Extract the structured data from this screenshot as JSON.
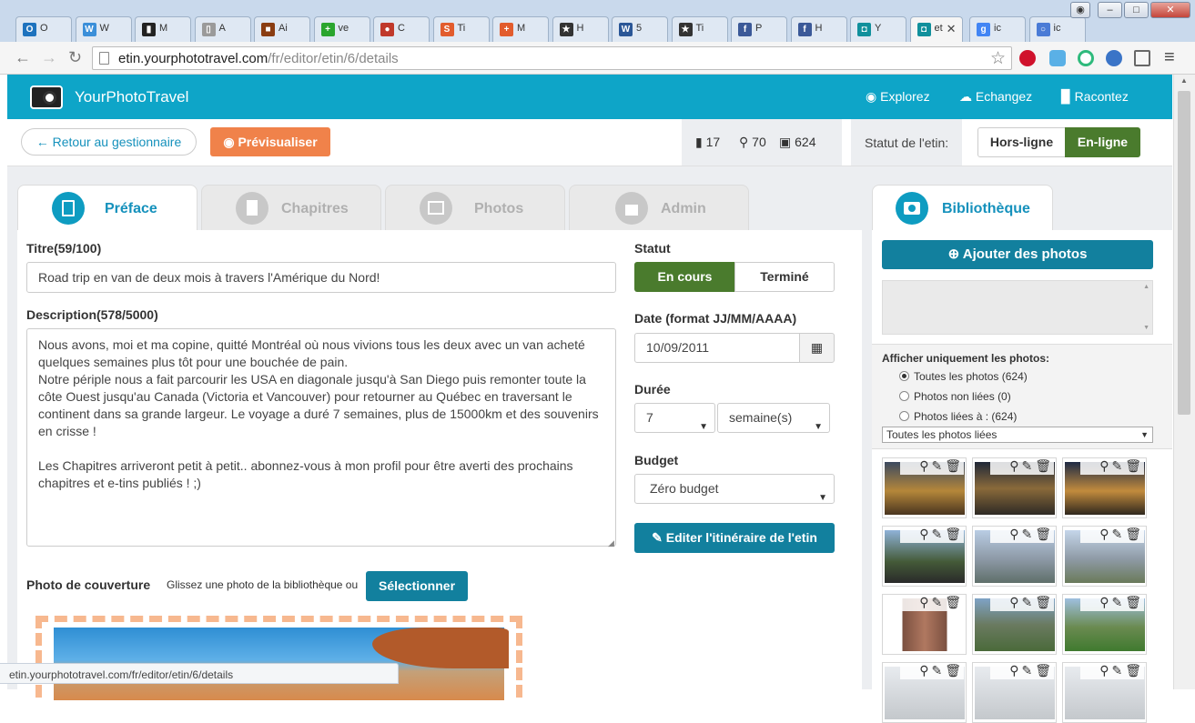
{
  "browser": {
    "tabs": [
      {
        "label": "O",
        "icon": "outlook-icon",
        "color": "#1e73be",
        "glyph": "O"
      },
      {
        "label": "W",
        "icon": "bird-icon",
        "color": "#3b8fd9",
        "glyph": "W"
      },
      {
        "label": "M",
        "icon": "barcode-icon",
        "color": "#222222",
        "glyph": "▮"
      },
      {
        "label": "A",
        "icon": "document-icon",
        "color": "#9a9a9a",
        "glyph": "▯"
      },
      {
        "label": "Ai",
        "icon": "image-icon",
        "color": "#8a3d12",
        "glyph": "■"
      },
      {
        "label": "ve",
        "icon": "plus-icon",
        "color": "#2aa52e",
        "glyph": "+"
      },
      {
        "label": "C",
        "icon": "circle-icon",
        "color": "#c0392b",
        "glyph": "●"
      },
      {
        "label": "Ti",
        "icon": "s-icon",
        "color": "#e25c2d",
        "glyph": "S"
      },
      {
        "label": "M",
        "icon": "cross-icon",
        "color": "#e25c2d",
        "glyph": "+"
      },
      {
        "label": "H",
        "icon": "star-icon",
        "color": "#333333",
        "glyph": "★"
      },
      {
        "label": "5",
        "icon": "word-icon",
        "color": "#2b5797",
        "glyph": "W"
      },
      {
        "label": "Ti",
        "icon": "star-icon",
        "color": "#333333",
        "glyph": "★"
      },
      {
        "label": "P",
        "icon": "facebook-icon",
        "color": "#3b5998",
        "glyph": "f"
      },
      {
        "label": "H",
        "icon": "facebook-icon",
        "color": "#3b5998",
        "glyph": "f"
      },
      {
        "label": "Y",
        "icon": "camera-icon",
        "color": "#11909c",
        "glyph": "◘"
      },
      {
        "label": "et",
        "icon": "camera-icon",
        "color": "#11909c",
        "glyph": "◘"
      },
      {
        "label": "ic",
        "icon": "google-icon",
        "color": "#4285f4",
        "glyph": "g"
      },
      {
        "label": "ic",
        "icon": "loading-icon",
        "color": "#4a7bd6",
        "glyph": "○"
      }
    ],
    "url_host": "etin.yourphototravel.com",
    "url_path": "/fr/editor/etin/6/details",
    "status_url": "etin.yourphototravel.com/fr/editor/etin/6/details"
  },
  "site": {
    "logo": "YourPhotoTravel",
    "menu": {
      "explore": "Explorez",
      "exchange": "Echangez",
      "tell": "Racontez"
    }
  },
  "toolbar": {
    "back": "← Retour au gestionnaire",
    "preview": "Prévisualiser",
    "counts": {
      "chapters": "17",
      "places": "70",
      "photos": "624"
    },
    "status_label": "Statut de l'etin:",
    "offline": "Hors-ligne",
    "online": "En-ligne"
  },
  "tabs": {
    "preface": "Préface",
    "chapters": "Chapitres",
    "photos": "Photos",
    "admin": "Admin",
    "library": "Bibliothèque"
  },
  "form": {
    "title_label": "Titre(59/100)",
    "title_value": "Road trip en van de deux mois à travers l'Amérique du Nord!",
    "description_label": "Description(578/5000)",
    "description_value": "Nous avons, moi et ma copine, quitté Montréal où nous vivions tous les deux avec un van acheté quelques semaines plus tôt pour une bouchée de pain.\nNotre périple nous a fait parcourir les USA en diagonale jusqu'à San Diego puis remonter toute la côte Ouest jusqu'au Canada (Victoria et Vancouver) pour retourner au Québec en traversant le continent dans sa grande largeur. Le voyage a duré 7 semaines, plus de 15000km et des souvenirs en crisse !\n\nLes Chapitres arriveront petit à petit.. abonnez-vous à mon profil pour être averti des prochains chapitres et e-tins publiés ! ;)",
    "status_label": "Statut",
    "status_ongoing": "En cours",
    "status_done": "Terminé",
    "date_label": "Date (format JJ/MM/AAAA)",
    "date_value": "10/09/2011",
    "duration_label": "Durée",
    "duration_value": "7",
    "duration_unit": "semaine(s)",
    "budget_label": "Budget",
    "budget_value": "Zéro budget",
    "edit_itinerary": "Editer l'itinéraire de l'etin",
    "cover_label": "Photo de couverture",
    "cover_hint": "Glissez une photo de la bibliothèque ou",
    "cover_select": "Sélectionner"
  },
  "library": {
    "add_photos": "Ajouter des photos",
    "filter_label": "Afficher uniquement les photos:",
    "options": [
      "Toutes les photos (624)",
      "Photos non liées (0)",
      "Photos liées à : (624)"
    ],
    "selected_option": 0,
    "linked_select": "Toutes les photos liées"
  },
  "colors": {
    "brand": "#0ea5c8",
    "orange": "#f0824a",
    "green": "#4a7b2d",
    "teal": "#12809e"
  }
}
